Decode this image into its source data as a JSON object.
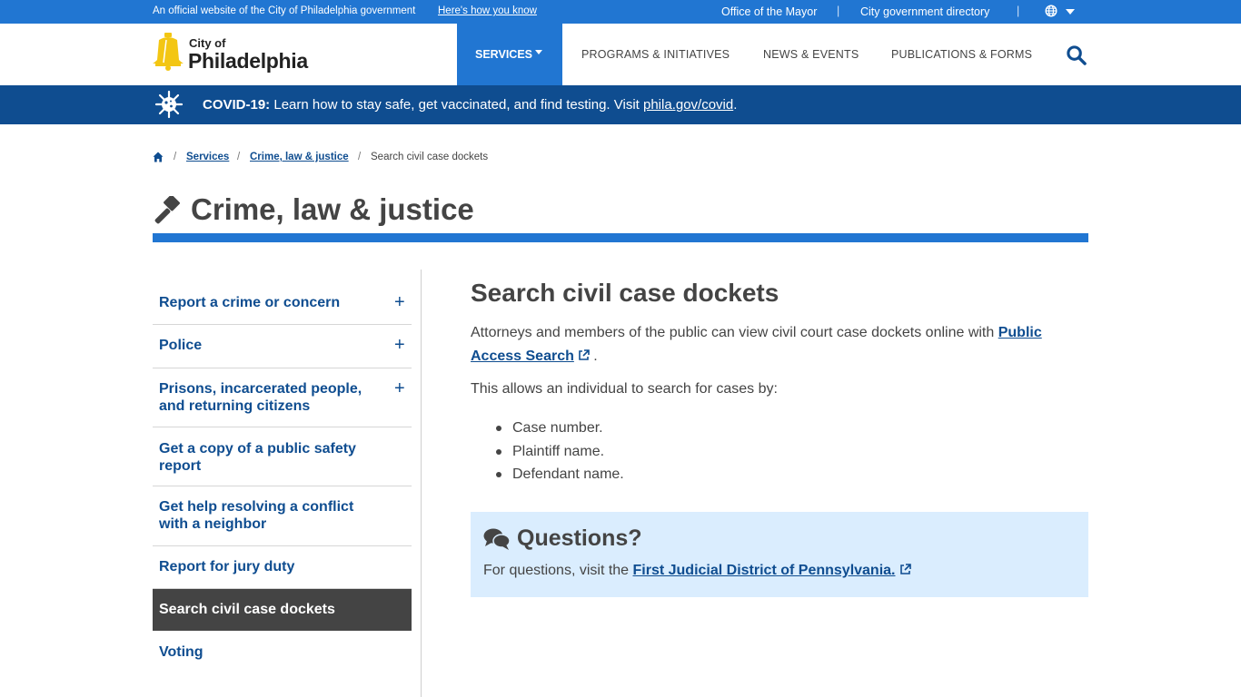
{
  "topbar": {
    "official_text": "An official website of the City of Philadelphia government",
    "how_you_know": "Here's how you know",
    "mayor_link": "Office of the Mayor",
    "separator": "|",
    "directory_link": "City government directory"
  },
  "header": {
    "logo_city_of": "City of",
    "logo_philadelphia": "Philadelphia",
    "nav": {
      "services": "SERVICES",
      "programs": "PROGRAMS & INITIATIVES",
      "news": "NEWS & EVENTS",
      "publications": "PUBLICATIONS & FORMS"
    }
  },
  "covid_banner": {
    "label": "COVID-19:",
    "message": " Learn how to stay safe, get vaccinated, and find testing. Visit ",
    "link": "phila.gov/covid",
    "suffix": "."
  },
  "breadcrumb": {
    "separator": "/",
    "items": [
      "Services",
      "Crime, law & justice"
    ],
    "current": "Search civil case dockets"
  },
  "page_title": "Crime, law & justice",
  "sidebar": {
    "items": [
      {
        "label": "Report a crime or concern",
        "expand": "+"
      },
      {
        "label": "Police",
        "expand": "+"
      },
      {
        "label": "Prisons, incarcerated people, and returning citizens",
        "expand": "+"
      },
      {
        "label": "Get a copy of a public safety report"
      },
      {
        "label": "Get help resolving a conflict with a neighbor"
      },
      {
        "label": "Report for jury duty"
      },
      {
        "label": "Search civil case dockets"
      },
      {
        "label": "Voting"
      }
    ]
  },
  "main": {
    "title": "Search civil case dockets",
    "intro_text": "Attorneys and members of the public can view civil court case dockets online with ",
    "intro_link": "Public Access Search",
    "intro_suffix": " .",
    "criteria_intro": "This allows an individual to search for cases by:",
    "criteria": [
      "Case number.",
      "Plaintiff name.",
      "Defendant name."
    ]
  },
  "questions": {
    "title": "Questions?",
    "text": "For questions, visit the ",
    "link": "First Judicial District of Pennsylvania."
  },
  "colors": {
    "primary_blue": "#2176d2",
    "dark_blue": "#0f4d90",
    "text_gray": "#444444",
    "callout_bg": "#daedfe",
    "logo_yellow": "#f3c613"
  }
}
